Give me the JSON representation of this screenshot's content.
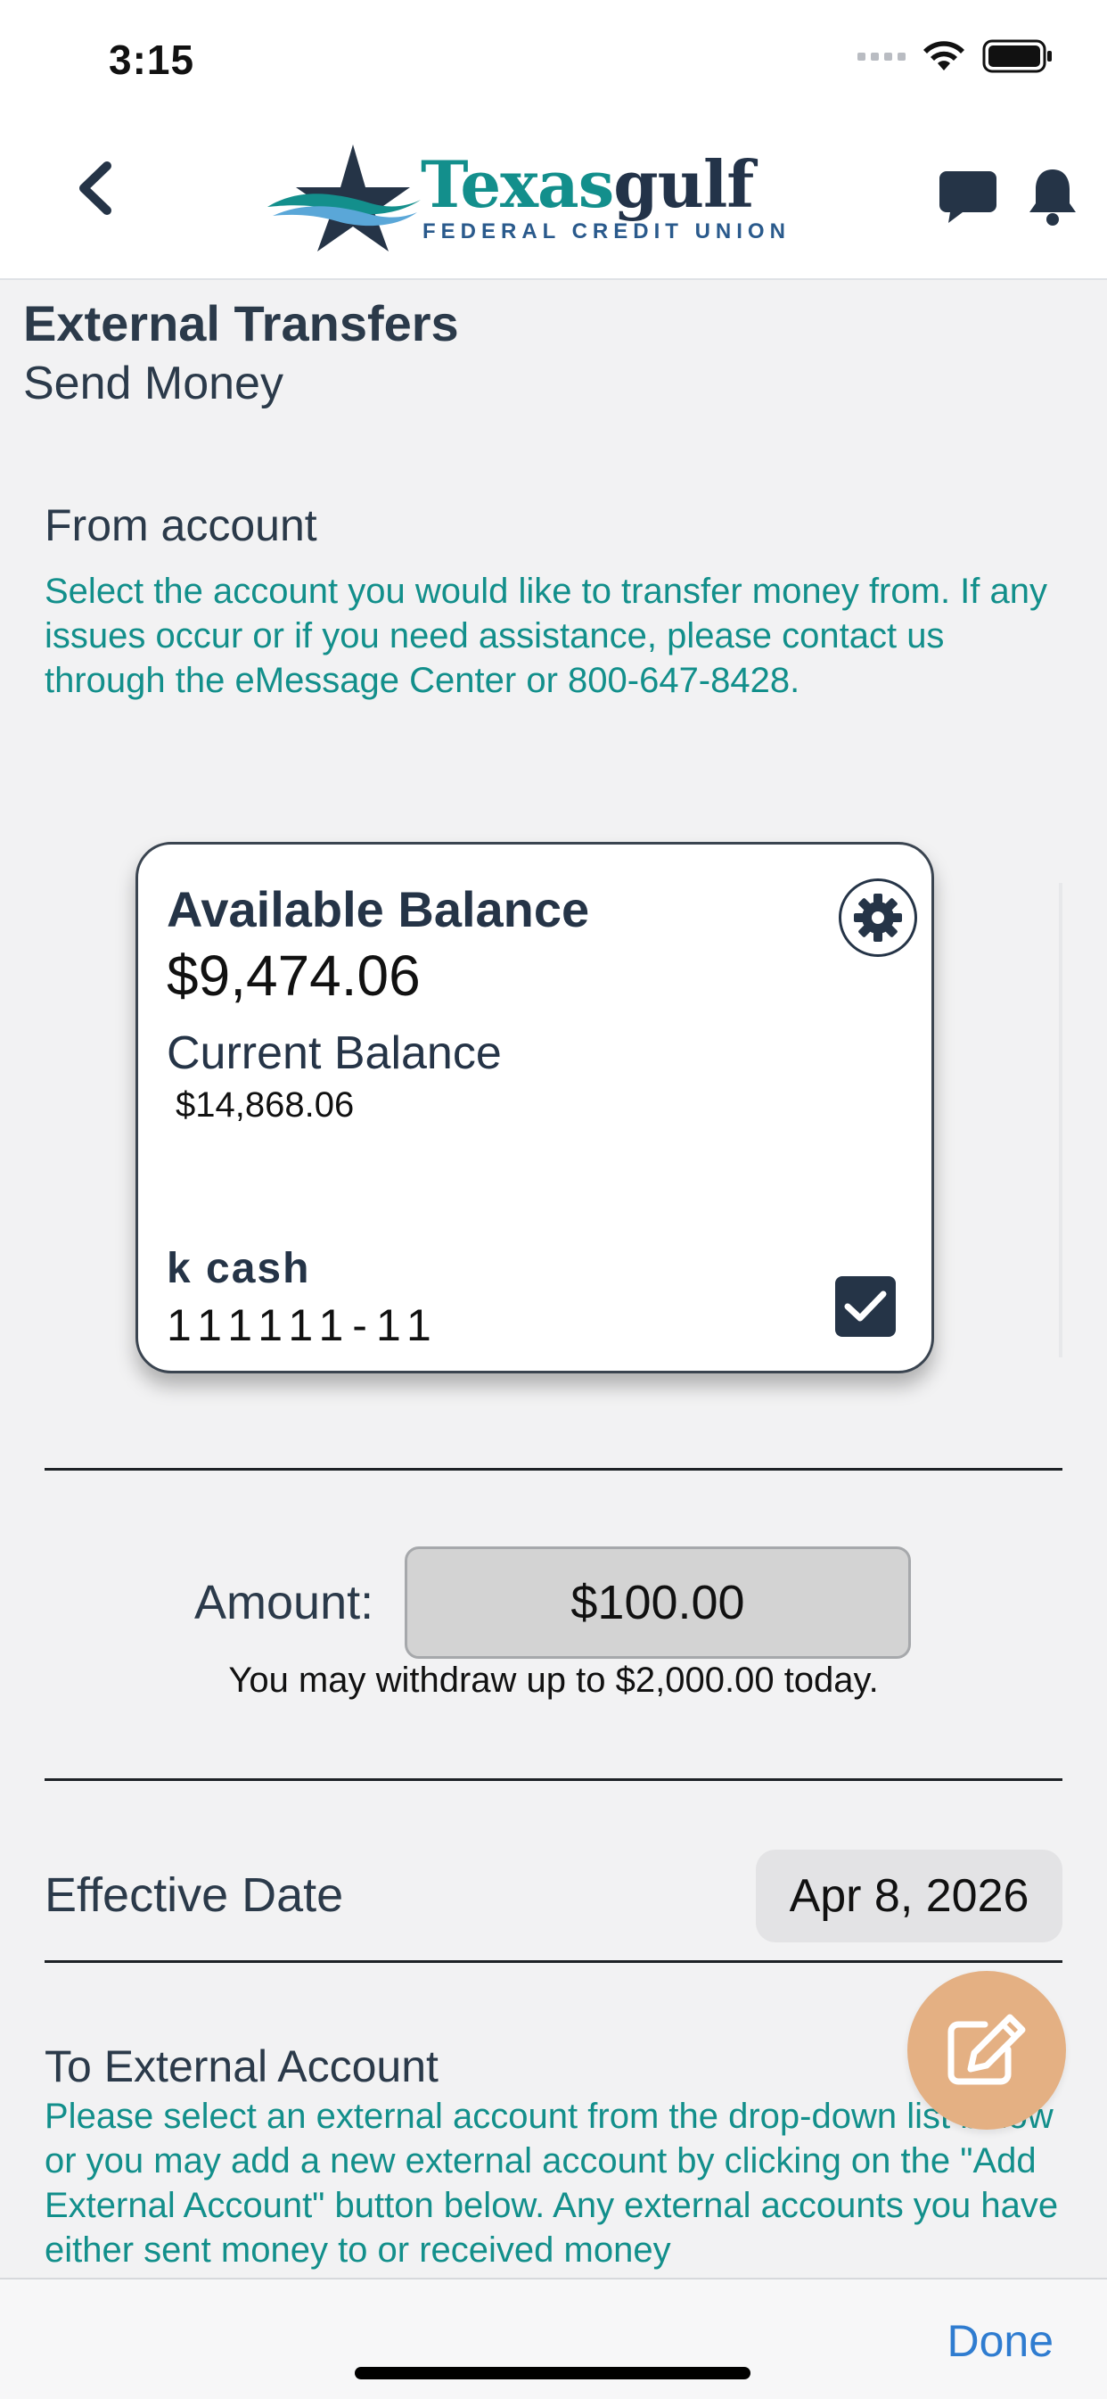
{
  "status_bar": {
    "time": "3:15"
  },
  "header": {
    "logo_word_1": "Texas",
    "logo_word_2": "gulf",
    "logo_sub": "FEDERAL CREDIT UNION"
  },
  "page": {
    "title": "External Transfers",
    "subtitle": "Send Money"
  },
  "from_account": {
    "title": "From account",
    "description": "Select the account you would like to transfer money from. If any issues occur or if you need assistance, please contact us through the eMessage Center or 800-647-8428."
  },
  "account_card": {
    "available_label": "Available Balance",
    "available_value": "$9,474.06",
    "current_label": "Current Balance",
    "current_value": "$14,868.06",
    "account_name": "k cash",
    "account_number": "111111-11",
    "selected": true
  },
  "amount": {
    "label": "Amount:",
    "value": "$100.00",
    "note": "You may withdraw up to $2,000.00 today."
  },
  "effective_date": {
    "label": "Effective Date",
    "value": "Apr 8, 2026"
  },
  "to_account": {
    "title": "To External Account",
    "description": "Please select an external account from the drop-down list below or you may add a new external account by clicking on the \"Add External Account\" button below. Any external accounts you have either sent money to or received money"
  },
  "bottom_bar": {
    "done_label": "Done"
  },
  "colors": {
    "teal": "#128f8b",
    "navy": "#253447",
    "fab": "#e4b083",
    "link_blue": "#2f7cd0"
  },
  "icons": [
    "back-chevron-icon",
    "chat-bubble-icon",
    "bell-icon",
    "gear-icon",
    "checkbox-checked-icon",
    "edit-pencil-icon",
    "wifi-icon",
    "battery-icon",
    "cellular-signal-icon"
  ]
}
